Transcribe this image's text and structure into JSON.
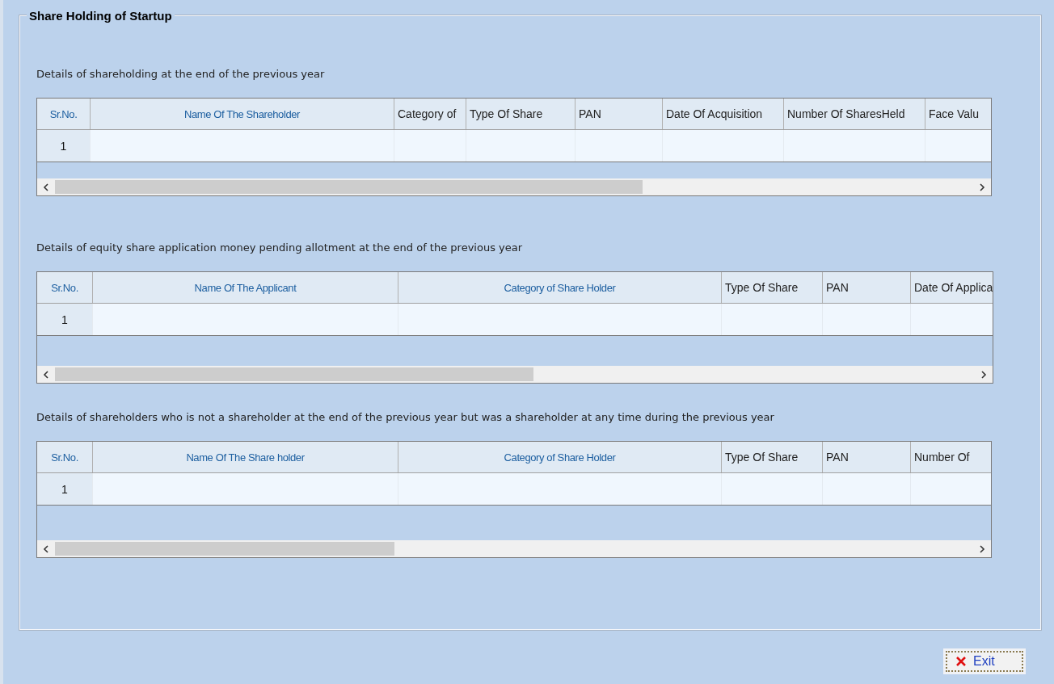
{
  "group": {
    "title": "Share Holding of Startup"
  },
  "sections": [
    {
      "caption": "Details of shareholding at the end of the previous year",
      "columns": [
        {
          "label": "Sr.No.",
          "kind": "blue"
        },
        {
          "label": "Name Of The Shareholder",
          "kind": "blue"
        },
        {
          "label": "Category of",
          "kind": "plain"
        },
        {
          "label": "Type Of Share",
          "kind": "plain"
        },
        {
          "label": "PAN",
          "kind": "plain"
        },
        {
          "label": "Date Of Acquisition",
          "kind": "plain"
        },
        {
          "label": "Number Of SharesHeld",
          "kind": "plain"
        },
        {
          "label": "Face Valu",
          "kind": "plain"
        }
      ],
      "rows": [
        {
          "sr_no": "1"
        }
      ]
    },
    {
      "caption": "Details of equity share application money pending allotment at the end of the previous year",
      "columns": [
        {
          "label": "Sr.No.",
          "kind": "blue"
        },
        {
          "label": "Name Of The Applicant",
          "kind": "blue"
        },
        {
          "label": "Category of Share Holder",
          "kind": "blue"
        },
        {
          "label": "Type Of Share",
          "kind": "plain"
        },
        {
          "label": "PAN",
          "kind": "plain"
        },
        {
          "label": "Date Of Applica",
          "kind": "plain"
        }
      ],
      "rows": [
        {
          "sr_no": "1"
        }
      ]
    },
    {
      "caption": "Details of shareholders who is not a shareholder at the end of the previous year but was a shareholder at any time during the previous year",
      "columns": [
        {
          "label": "Sr.No.",
          "kind": "blue"
        },
        {
          "label": "Name Of The Share holder",
          "kind": "blue"
        },
        {
          "label": "Category of Share Holder",
          "kind": "blue"
        },
        {
          "label": "Type Of Share",
          "kind": "plain"
        },
        {
          "label": "PAN",
          "kind": "plain"
        },
        {
          "label": "Number Of",
          "kind": "plain"
        }
      ],
      "rows": [
        {
          "sr_no": "1"
        }
      ]
    }
  ],
  "exit_button": {
    "label": "Exit"
  }
}
